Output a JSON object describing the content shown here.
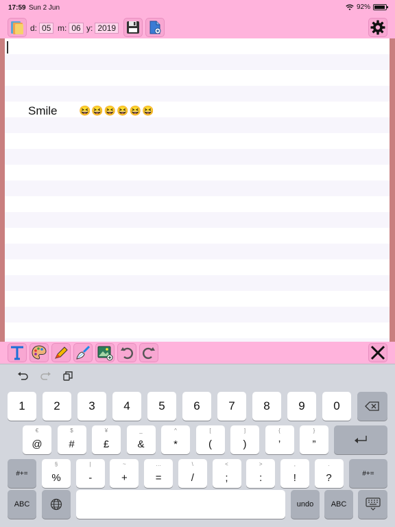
{
  "status": {
    "time": "17:59",
    "date": "Sun 2 Jun",
    "battery": "92%",
    "battery_level": 0.92
  },
  "toolbar": {
    "day_label": "d:",
    "day_value": "05",
    "month_label": "m:",
    "month_value": "06",
    "year_label": "y:",
    "year_value": "2019"
  },
  "note": {
    "text": "Smile",
    "emoji": "😆😆😆😆😆😆"
  },
  "keyboard": {
    "row1": [
      "1",
      "2",
      "3",
      "4",
      "5",
      "6",
      "7",
      "8",
      "9",
      "0"
    ],
    "row2": [
      {
        "main": "@",
        "alt": "€"
      },
      {
        "main": "#",
        "alt": "$"
      },
      {
        "main": "£",
        "alt": "¥"
      },
      {
        "main": "&",
        "alt": "_"
      },
      {
        "main": "*",
        "alt": "^"
      },
      {
        "main": "(",
        "alt": "["
      },
      {
        "main": ")",
        "alt": "]"
      },
      {
        "main": "’",
        "alt": "{"
      },
      {
        "main": "”",
        "alt": "}"
      }
    ],
    "row3": [
      {
        "main": "%",
        "alt": "§"
      },
      {
        "main": "-",
        "alt": "|"
      },
      {
        "main": "+",
        "alt": "~"
      },
      {
        "main": "=",
        "alt": "…"
      },
      {
        "main": "/",
        "alt": "\\"
      },
      {
        "main": ";",
        "alt": "<"
      },
      {
        "main": ":",
        "alt": ">"
      },
      {
        "main": "!",
        "alt": ","
      },
      {
        "main": "?",
        "alt": "."
      }
    ],
    "symbols_label": "#+=",
    "abc_label": "ABC",
    "undo_label": "undo"
  }
}
